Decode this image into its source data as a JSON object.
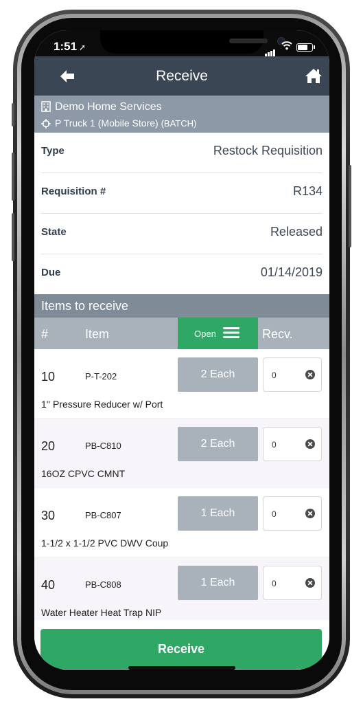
{
  "status_bar": {
    "time": "1:51"
  },
  "nav": {
    "title": "Receive"
  },
  "location": {
    "company": "Demo Home Services",
    "store": "P Truck 1 (Mobile Store)",
    "mode": "(BATCH)"
  },
  "details": [
    {
      "label": "Type",
      "value": "Restock Requisition"
    },
    {
      "label": "Requisition #",
      "value": "R134"
    },
    {
      "label": "State",
      "value": "Released"
    },
    {
      "label": "Due",
      "value": "01/14/2019"
    }
  ],
  "items_section": {
    "title": "Items to receive",
    "columns": {
      "num": "#",
      "item": "Item",
      "open": "Open",
      "recv": "Recv."
    },
    "rows": [
      {
        "num": "10",
        "code": "P-T-202",
        "qty": "2 Each",
        "recv": "0",
        "desc": "1'' Pressure Reducer w/ Port"
      },
      {
        "num": "20",
        "code": "PB-C810",
        "qty": "2 Each",
        "recv": "0",
        "desc": "16OZ CPVC CMNT"
      },
      {
        "num": "30",
        "code": "PB-C807",
        "qty": "1 Each",
        "recv": "0",
        "desc": "1-1/2 x 1-1/2 PVC DWV Coup"
      },
      {
        "num": "40",
        "code": "PB-C808",
        "qty": "1 Each",
        "recv": "0",
        "desc": "Water Heater Heat Trap NIP"
      }
    ]
  },
  "footer": {
    "receive_label": "Receive"
  },
  "colors": {
    "nav_bg": "#3b4654",
    "accent_green": "#2fa865",
    "location_bg": "#8d99a6",
    "column_bg": "#a9b1bb"
  }
}
